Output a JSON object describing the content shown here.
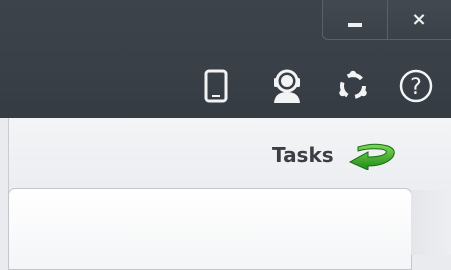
{
  "window": {
    "minimize_icon": "minimize-icon",
    "close_label": "×"
  },
  "toolbar": {
    "icons": [
      "mobile-device-icon",
      "support-agent-icon",
      "sync-icon",
      "help-icon"
    ],
    "help_label": "?"
  },
  "tasks": {
    "label": "Tasks",
    "icon": "green-arrow-icon"
  },
  "colors": {
    "titlebar": "#3a4047",
    "content": "#eceef1",
    "accent_green": "#3fae2a"
  }
}
